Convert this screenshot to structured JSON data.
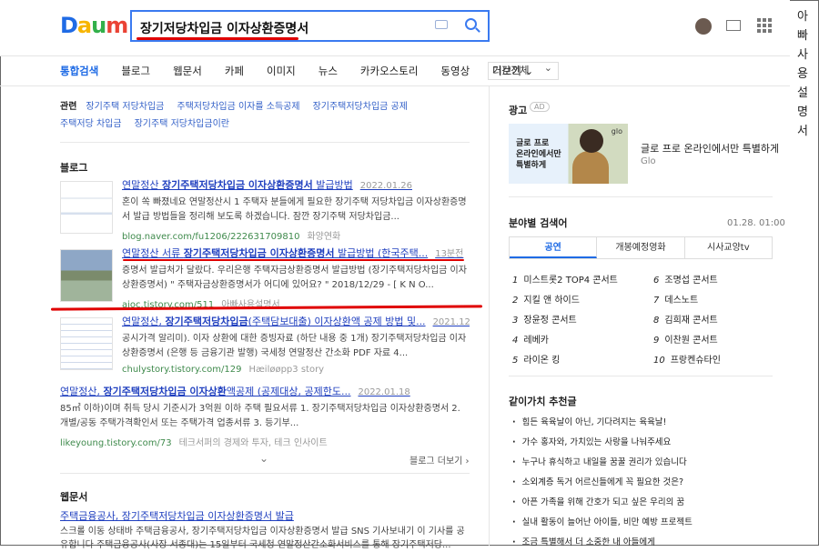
{
  "logo": {
    "letters": [
      "D",
      "a",
      "u",
      "m"
    ]
  },
  "search": {
    "query": "장기저당차입금 이자상환증명서"
  },
  "vertical_title": [
    "아",
    "빠",
    "사",
    "용",
    "설",
    "명",
    "서"
  ],
  "tabs": [
    "통합검색",
    "블로그",
    "웹문서",
    "카페",
    "이미지",
    "뉴스",
    "카카오스토리",
    "동영상",
    "더보기 ⌄"
  ],
  "period": "기간전체",
  "related": {
    "label": "관련",
    "items": [
      "장기주택 저당차입금",
      "주택저당차입금 이자를 소득공제",
      "장기주택저당차입금 공제",
      "주택저당 차입금",
      "장기주택 저당차입금이란"
    ]
  },
  "blog": {
    "title": "블로그",
    "items": [
      {
        "title_pre": "연말정산 ",
        "title_bold": "장기주택저당차입금 이자상환증명서",
        "title_post": " 발급방법",
        "date": "2022.01.26",
        "desc": "혼이 쏙 빠졌네요  연말정산시 1 주택자 분들에게 필요한 장기주택 저당차입금 이자상환증명서 발급 방법들을 정리해 보도록 하겠습니다.  잠깐 장기주택 저당차입금...",
        "src": "blog.naver.com/fu1206/222631709810",
        "author": "화양연화"
      },
      {
        "title_pre": "연말정산 서류 ",
        "title_bold": "장기주택저당차입금 이자상환증명서",
        "title_post": " 발급방법 (한국주택...",
        "date": "13분전",
        "desc": "증명서 발급처가 달랐다. 우리은행 주택자금상환증명서 발급방법 (장기주택저당차입금 이자상환증명서) \" 주택자금상환증명서가 어디에 있어요? \" 2018/12/29 - [ K N O...",
        "src": "ajoc.tistory.com/511",
        "author": "아빠사용설명서"
      },
      {
        "title_pre": "연말정산, ",
        "title_bold": "장기주택저당차입금",
        "title_post": "(주택담보대출) 이자상환액 공제 방법 및...",
        "date": "2021.12.28",
        "desc": "공시가격 알리미). 이자 상환에 대한 증빙자료 (하단 내용 중 1개) 장기주택저당차입금 이자상환증명서 (은행 등 금융기관 발행) 국세청 연말정산 간소화 PDF 자료 4...",
        "src": "chulystory.tistory.com/129",
        "author": "Hæiløøpp3 story"
      },
      {
        "title_pre": "연말정산, ",
        "title_bold": "장기주택저당차입금 이자상환",
        "title_post": "액공제 (공제대상, 공제한도...",
        "date": "2022.01.18",
        "desc": "85㎡ 이하)이며 취득 당시 기준시가 3억원 이하 주택 필요서류 1. 장기주택저당차입금 이자상환증명서 2. 개별/공동 주택가격확인서 또는 주택가격 업종서류 3. 등기부...",
        "src": "likeyoung.tistory.com/73",
        "author": "테크서퍼의 경제와 투자, 테크 인사이트"
      }
    ],
    "more": "블로그 더보기 ›"
  },
  "web": {
    "title": "웹문서",
    "item_title": "주택금융공사, 장기주택저당차입금 이자상환증명서 발급",
    "item_desc": "스크롤 이동 상태바 주택금융공사, 장기주택저당차입금 이자상환증명서 발급 SNS 기사보내기 이 기사를 공유합니다 주택금융공사(사장 서종대)는 15일부터 국세청 연말정산간소화서비스를 통해 장기주택저당..."
  },
  "ad": {
    "label": "광고",
    "badge": "AD",
    "img_text": "글로 프로\n온라인에서만\n특별하게",
    "logo": "glo",
    "copy": "글로 프로 온라인에서만 특별하게",
    "sub": "Glo"
  },
  "ranking": {
    "title": "분야별 검색어",
    "time": "01.28. 01:00",
    "tabs": [
      "공연",
      "개봉예정영화",
      "시사교양tv"
    ],
    "left": [
      [
        "1",
        "미스트롯2 TOP4 콘서트"
      ],
      [
        "2",
        "지킬 앤 하이드"
      ],
      [
        "3",
        "장윤정 콘서트"
      ],
      [
        "4",
        "레베카"
      ],
      [
        "5",
        "라이온 킹"
      ]
    ],
    "right": [
      [
        "6",
        "조명섭 콘서트"
      ],
      [
        "7",
        "데스노트"
      ],
      [
        "8",
        "김희재 콘서트"
      ],
      [
        "9",
        "이찬원 콘서트"
      ],
      [
        "10",
        "프랑켄슈타인"
      ]
    ]
  },
  "values": {
    "title": "같이가치 추천글",
    "items": [
      "힘든 육육날이 아닌, 기다려지는 육육날!",
      "가수 홍자와, 가치있는 사랑을 나눠주세요",
      "누구나 휴식하고 내일을 꿈꿀 권리가 있습니다",
      "소외계층 독거 어르신들에게 꼭 필요한 것은?",
      "아픈 가족을 위해 간호가 되고 싶은 우리의 꿈",
      "실내 활동이 늘어난 아이들, 비만 예방 프로젝트",
      "조금 특별해서 더 소중한 내 아들에게"
    ]
  }
}
